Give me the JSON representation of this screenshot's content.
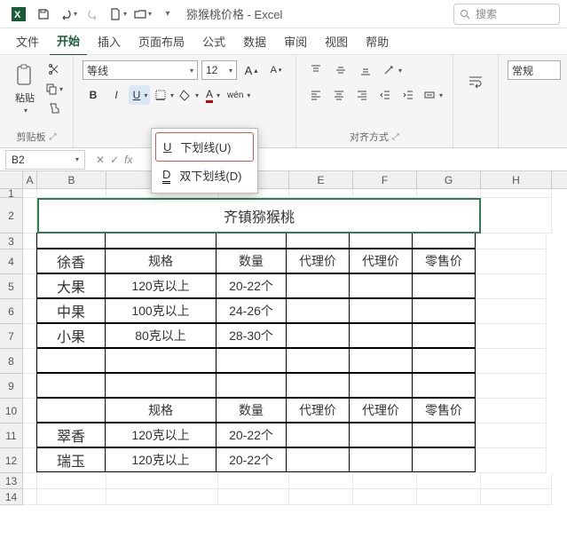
{
  "title": "猕猴桃价格 - Excel",
  "search_placeholder": "搜索",
  "tabs": [
    "文件",
    "开始",
    "插入",
    "页面布局",
    "公式",
    "数据",
    "审阅",
    "视图",
    "帮助"
  ],
  "active_tab": "开始",
  "ribbon": {
    "paste_label": "粘贴",
    "clipboard_label": "剪贴板",
    "font_name": "等线",
    "font_size": "12",
    "alignment_label": "对齐方式",
    "general_label": "常规"
  },
  "underline_menu": {
    "single": "下划线(U)",
    "double": "双下划线(D)"
  },
  "name_box": "B2",
  "chart_data": {
    "type": "table",
    "title": "齐镇猕猴桃",
    "sections": [
      {
        "name": "徐香",
        "header": [
          "规格",
          "数量",
          "代理价",
          "代理价",
          "零售价"
        ],
        "rows": [
          {
            "label": "大果",
            "spec": "120克以上",
            "qty": "20-22个"
          },
          {
            "label": "中果",
            "spec": "100克以上",
            "qty": "24-26个"
          },
          {
            "label": "小果",
            "spec": "80克以上",
            "qty": "28-30个"
          }
        ]
      },
      {
        "header": [
          "规格",
          "数量",
          "代理价",
          "代理价",
          "零售价"
        ],
        "rows": [
          {
            "label": "翠香",
            "spec": "120克以上",
            "qty": "20-22个"
          },
          {
            "label": "瑞玉",
            "spec": "120克以上",
            "qty": "20-22个"
          }
        ]
      }
    ]
  }
}
